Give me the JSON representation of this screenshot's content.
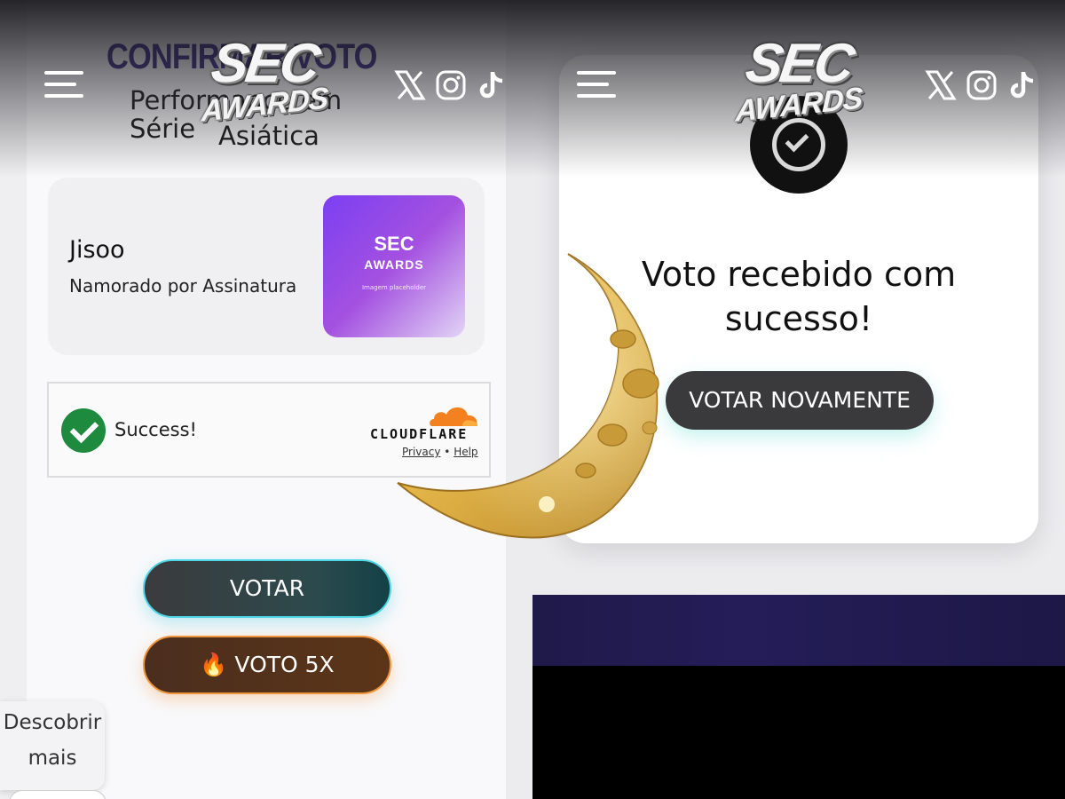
{
  "left_screen": {
    "title": "CONFIRMAR VOTO",
    "category_line1": "Performance em Série",
    "category_line2": "Asiática",
    "candidate": {
      "name": "Jisoo",
      "subtitle": "Namorado por Assinatura",
      "thumb_line1": "SEC",
      "thumb_line2": "AWARDS",
      "thumb_caption": "Imagem placeholder"
    },
    "captcha": {
      "status": "Success!",
      "brand": "CLOUDFLARE",
      "privacy": "Privacy",
      "separator": "•",
      "help": "Help"
    },
    "vote_button": "VOTAR",
    "vote5x_button": "🔥 VOTO 5X",
    "discover_line1": "Descobrir",
    "discover_line2": "mais"
  },
  "right_screen": {
    "message_line1": "Voto recebido com",
    "message_line2": "sucesso!",
    "again_button": "VOTAR NOVAMENTE"
  },
  "header": {
    "logo_line1": "SEC",
    "logo_line2": "AWARDS",
    "social_icons": [
      "x-icon",
      "instagram-icon",
      "tiktok-icon"
    ]
  },
  "colors": {
    "title_purple": "#3a2a82",
    "vote_border": "#4fd6e6",
    "vote5x_border": "#f0943b",
    "success_green": "#1e8a3e",
    "cloudflare_orange": "#f48120",
    "moon_gold": "#d9a93a"
  }
}
